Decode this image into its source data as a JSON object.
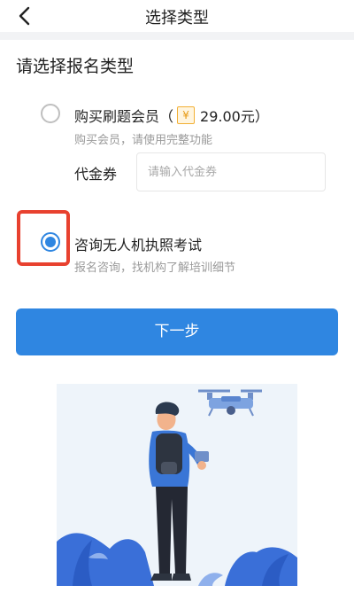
{
  "header": {
    "title": "选择类型"
  },
  "section": {
    "title": "请选择报名类型"
  },
  "options": [
    {
      "label_prefix": "购买刷题会员（",
      "price_icon": "¥",
      "label_suffix": "29.00元）",
      "description": "购买会员，请使用完整功能",
      "selected": false
    },
    {
      "label": "咨询无人机执照考试",
      "description": "报名咨询，找机构了解培训细节",
      "selected": true
    }
  ],
  "voucher": {
    "label": "代金券",
    "placeholder": "请输入代金券",
    "value": ""
  },
  "next_button": {
    "label": "下一步"
  },
  "colors": {
    "primary": "#2f86e1",
    "highlight": "#e8412f",
    "page_divider": "#f2f3f5"
  },
  "icons": {
    "back": "chevron-left-icon",
    "coin": "yuan-coin-icon",
    "illustration": "drone-pilot-illustration"
  }
}
